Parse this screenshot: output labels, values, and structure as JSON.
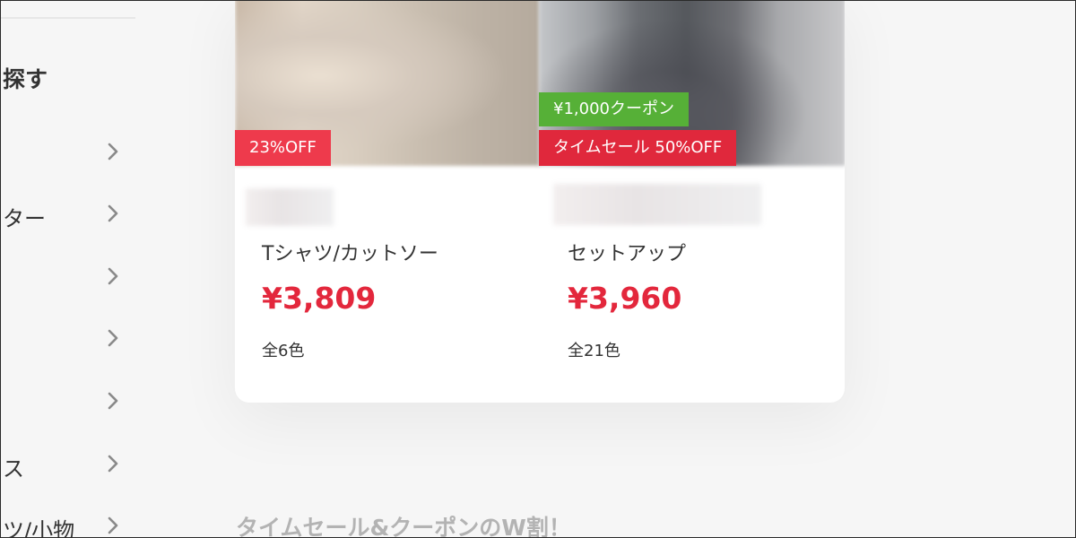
{
  "sidebar": {
    "heading": "探す",
    "items": [
      {
        "label": ""
      },
      {
        "label": "ター"
      },
      {
        "label": ""
      },
      {
        "label": ""
      },
      {
        "label": ""
      },
      {
        "label": "ス"
      },
      {
        "label": "ツ/小物"
      }
    ],
    "chevron_icon": "chevron-right-icon"
  },
  "products": [
    {
      "name": "Tシャツ/カットソー",
      "price": "¥3,809",
      "colors": "全6色",
      "badges": {
        "discount": "23%OFF"
      }
    },
    {
      "name": "セットアップ",
      "price": "¥3,960",
      "colors": "全21色",
      "badges": {
        "coupon": "¥1,000クーポン",
        "time_sale": "タイムセール 50%OFF"
      }
    }
  ],
  "section": {
    "title": "タイムセール&クーポンのW割！"
  },
  "colors": {
    "price_red": "#e3273c",
    "badge_red": "#ee3a4c",
    "badge_green": "#56b037",
    "background": "#f6f6f6"
  }
}
